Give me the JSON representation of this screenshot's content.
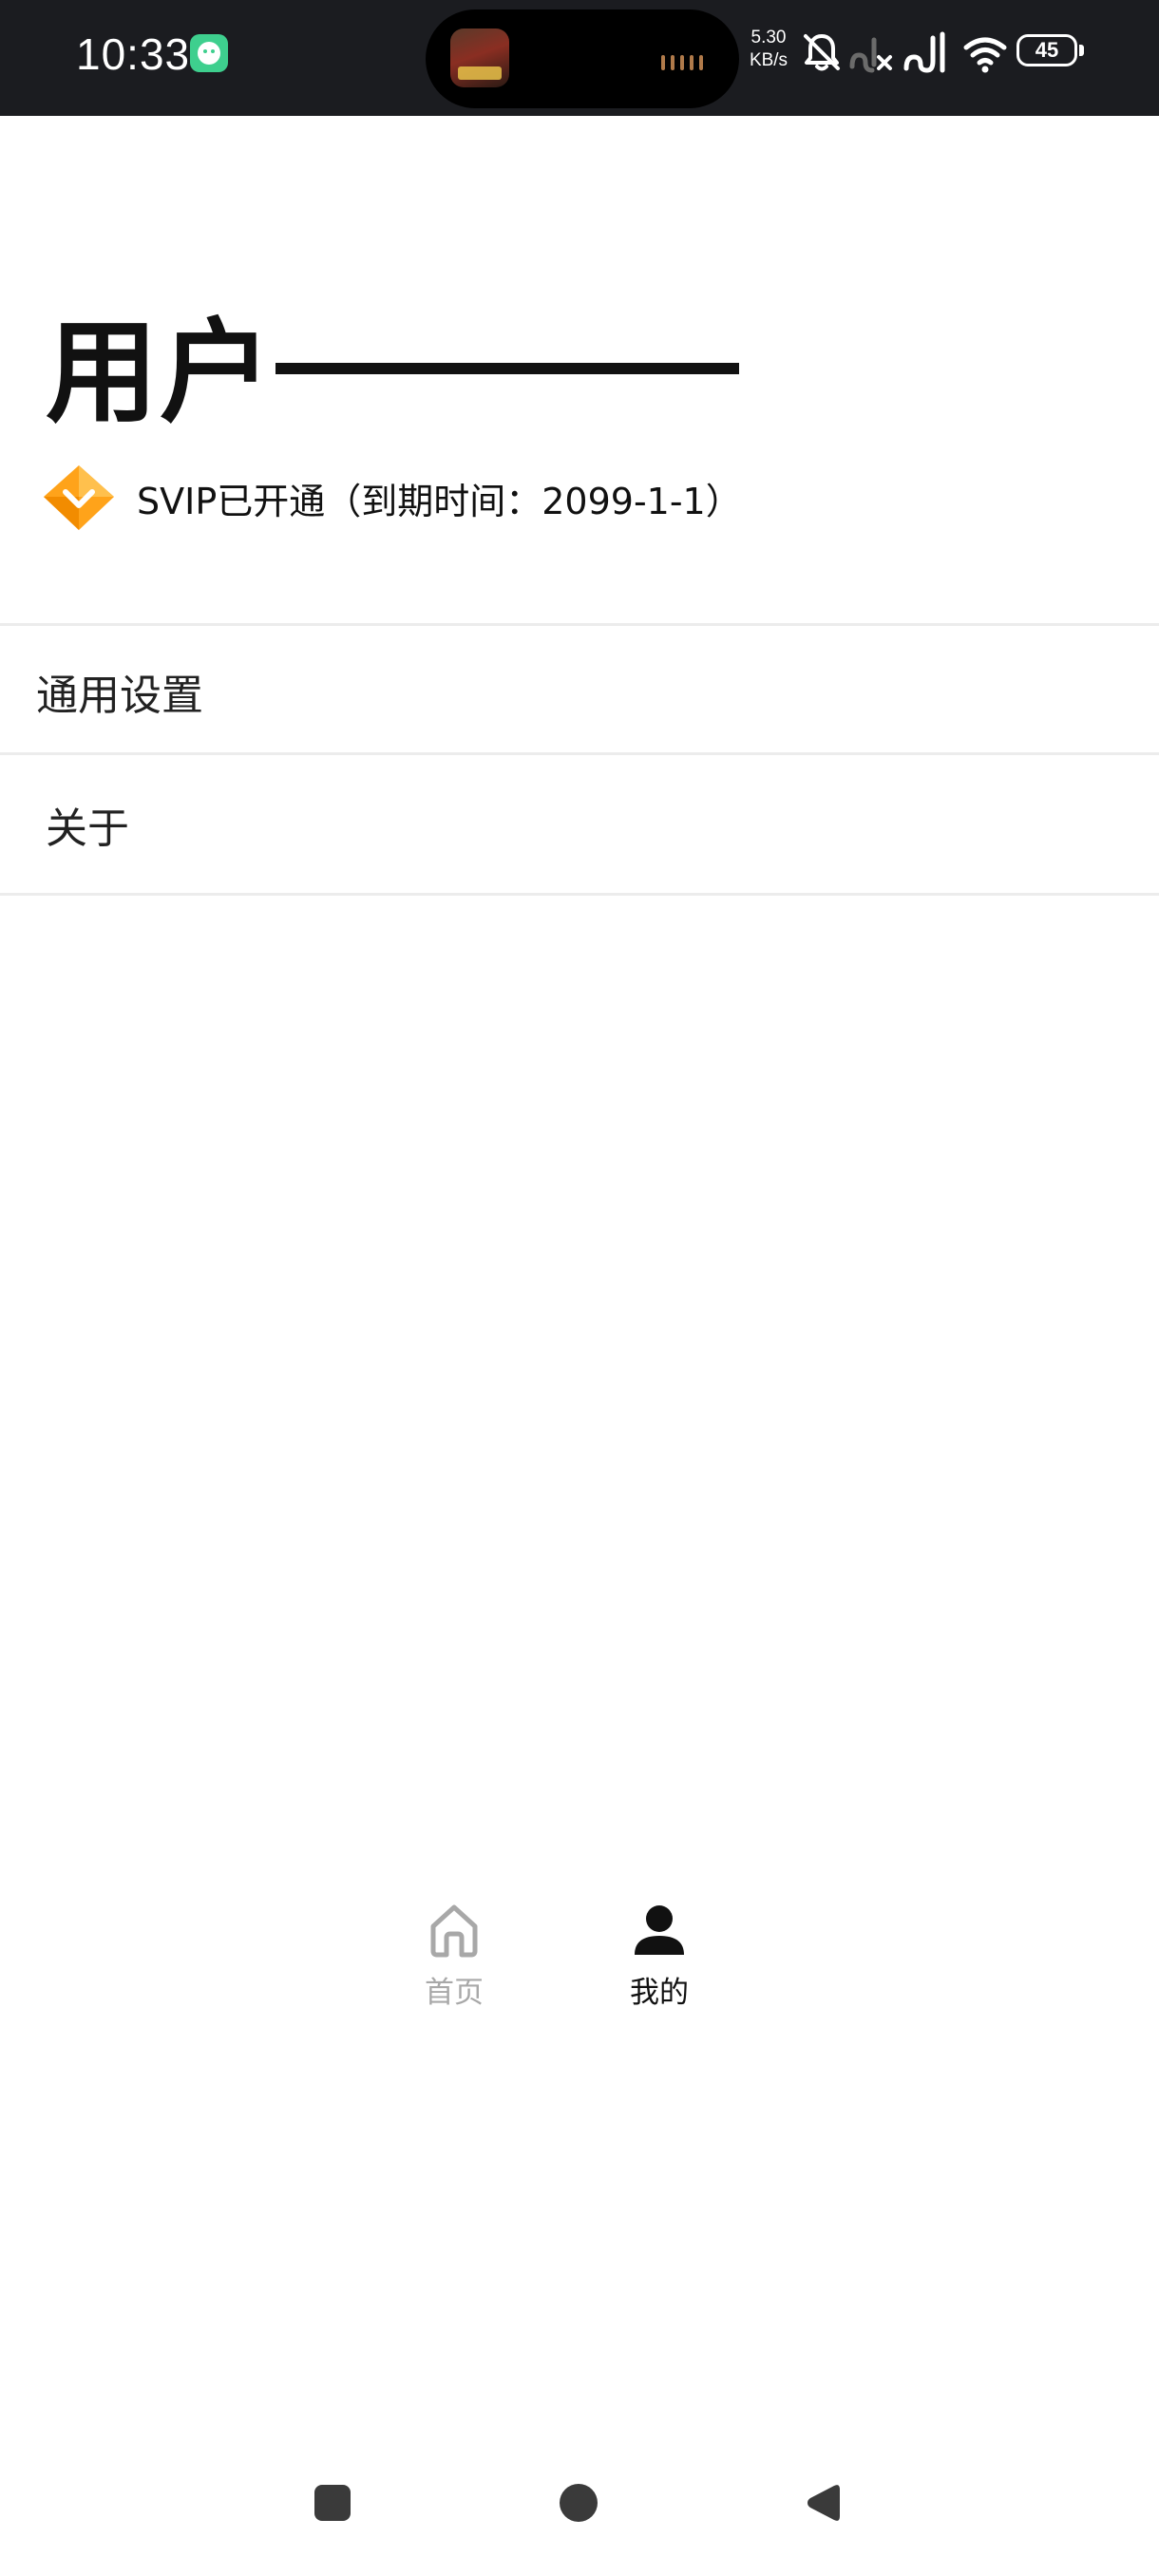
{
  "status_bar": {
    "time": "10:33",
    "net_speed_value": "5.30",
    "net_speed_unit": "KB/s",
    "battery_level": "45",
    "icons": [
      "app-notification-icon",
      "bell-muted-icon",
      "signal-x-icon",
      "signal-icon",
      "wifi-icon",
      "battery-icon"
    ]
  },
  "profile": {
    "user_name": "用户",
    "vip_status": "SVIP已开通（到期时间：2099-1-1）",
    "vip_icon": "diamond-icon",
    "vip_color": "#ffa31a"
  },
  "menu": {
    "items": [
      {
        "label": "通用设置"
      },
      {
        "label": "关于"
      }
    ]
  },
  "tab_bar": {
    "tabs": [
      {
        "label": "首页",
        "icon": "home-icon",
        "active": false
      },
      {
        "label": "我的",
        "icon": "person-icon",
        "active": true
      }
    ],
    "active_color": "#111111",
    "inactive_color": "#a8a8a8"
  },
  "nav_bar": {
    "buttons": [
      "recent-apps-icon",
      "home-circle-icon",
      "back-triangle-icon"
    ]
  }
}
